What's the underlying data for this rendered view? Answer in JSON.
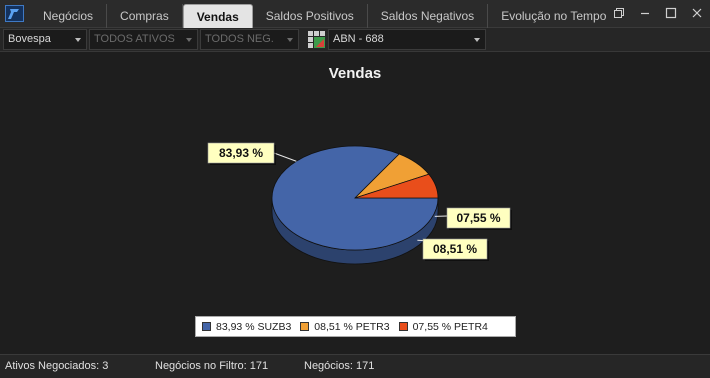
{
  "tabs": [
    {
      "label": "Negócios",
      "active": false
    },
    {
      "label": "Compras",
      "active": false
    },
    {
      "label": "Vendas",
      "active": true
    },
    {
      "label": "Saldos Positivos",
      "active": false
    },
    {
      "label": "Saldos Negativos",
      "active": false
    },
    {
      "label": "Evolução no Tempo",
      "active": false
    }
  ],
  "window_controls": [
    "restore-icon",
    "minimize-icon",
    "maximize-icon",
    "close-icon"
  ],
  "filters": {
    "market": "Bovespa",
    "assets": "TODOS ATIVOS",
    "trades": "TODOS NEG.",
    "broker": "ABN - 688"
  },
  "colors": {
    "background": "#1e1e1e",
    "active_tab": "#e4e4e4",
    "label_bg": "#ffffc0"
  },
  "chart_data": {
    "type": "pie",
    "title": "Vendas",
    "slices": [
      {
        "label": "83,93 %",
        "legend": "83,93 % SUZB3",
        "value": 83.93,
        "color": "#4465a8"
      },
      {
        "label": "08,51 %",
        "legend": "08,51 % PETR3",
        "value": 8.51,
        "color": "#f0a035"
      },
      {
        "label": "07,55 %",
        "legend": "07,55 % PETR4",
        "value": 7.55,
        "color": "#e94e1b"
      }
    ],
    "legend_position": "bottom"
  },
  "status": {
    "ativos": "Ativos Negociados: 3",
    "filtro": "Negócios no Filtro: 171",
    "negocios": "Negócios: 171"
  }
}
